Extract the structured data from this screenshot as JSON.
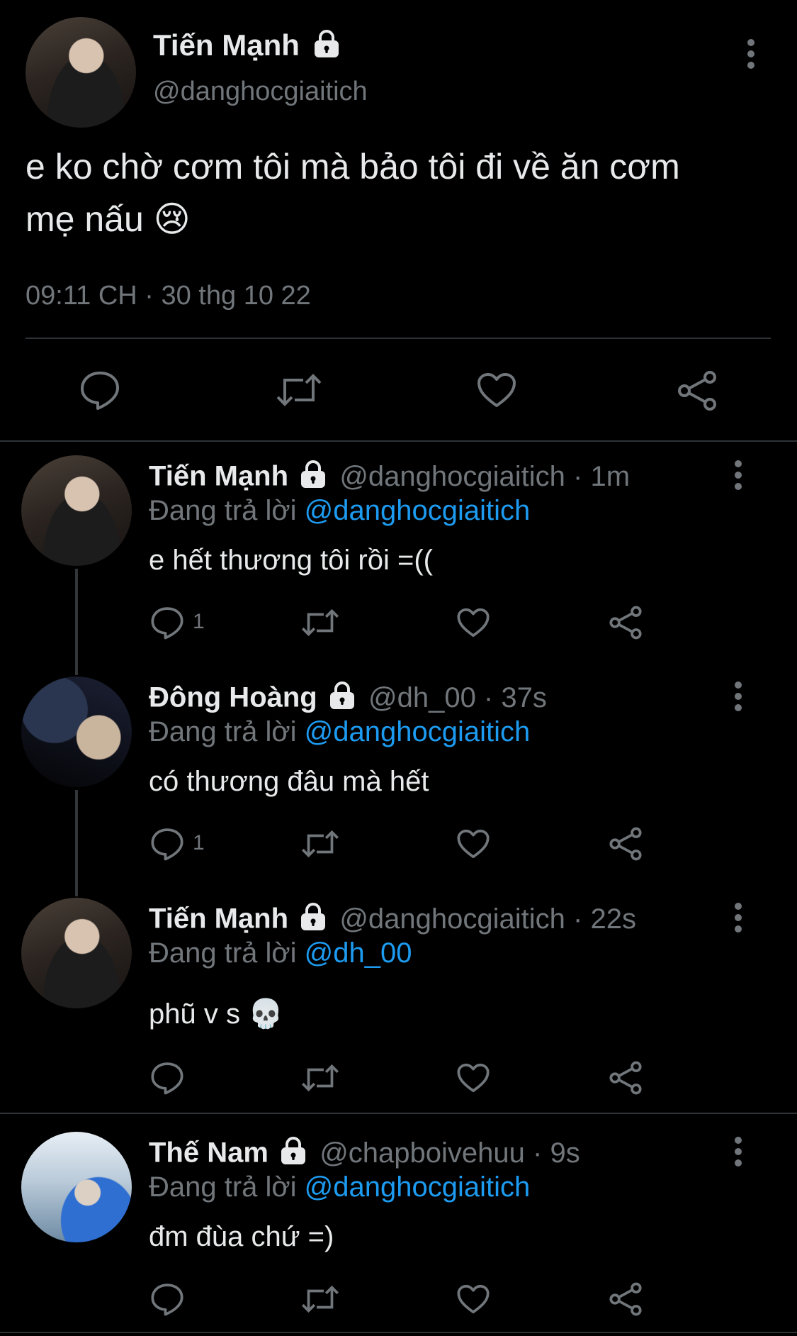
{
  "main_tweet": {
    "name": "Tiến Mạnh",
    "handle": "@danghocgiaitich",
    "text_line1": "e ko chờ cơm tôi mà bảo tôi đi về ăn cơm",
    "text_line2": "mẹ nấu 😢",
    "timestamp": "09:11 CH · 30 thg 10 22",
    "icons": [
      "comment-icon",
      "retweet-icon",
      "like-icon",
      "share-icon"
    ]
  },
  "replies": [
    {
      "name": "Tiến Mạnh",
      "handle_time": "@danghocgiaitich · 1m",
      "replying_prefix": "Đang trả lời",
      "replying_to": "@danghocgiaitich",
      "text": "e hết thương tôi rồi =((",
      "reply_count": "1"
    },
    {
      "name": "Đông Hoàng",
      "handle_time": "@dh_00 · 37s",
      "replying_prefix": "Đang trả lời",
      "replying_to": "@danghocgiaitich",
      "text": "có thương đâu mà hết",
      "reply_count": "1"
    },
    {
      "name": "Tiến Mạnh",
      "handle_time": "@danghocgiaitich · 22s",
      "replying_prefix": "Đang trả lời",
      "replying_to": "@dh_00",
      "text": "phũ v s 💀",
      "reply_count": ""
    },
    {
      "name": "Thế Nam",
      "handle_time": "@chapboivehuu · 9s",
      "replying_prefix": "Đang trả lời",
      "replying_to": "@danghocgiaitich",
      "text": "đm đùa chứ =)",
      "reply_count": ""
    }
  ],
  "colors": {
    "background": "#000000",
    "text": "#e7e9ea",
    "muted": "#71767b",
    "accent": "#1d9bf0",
    "divider": "#2f3336"
  }
}
